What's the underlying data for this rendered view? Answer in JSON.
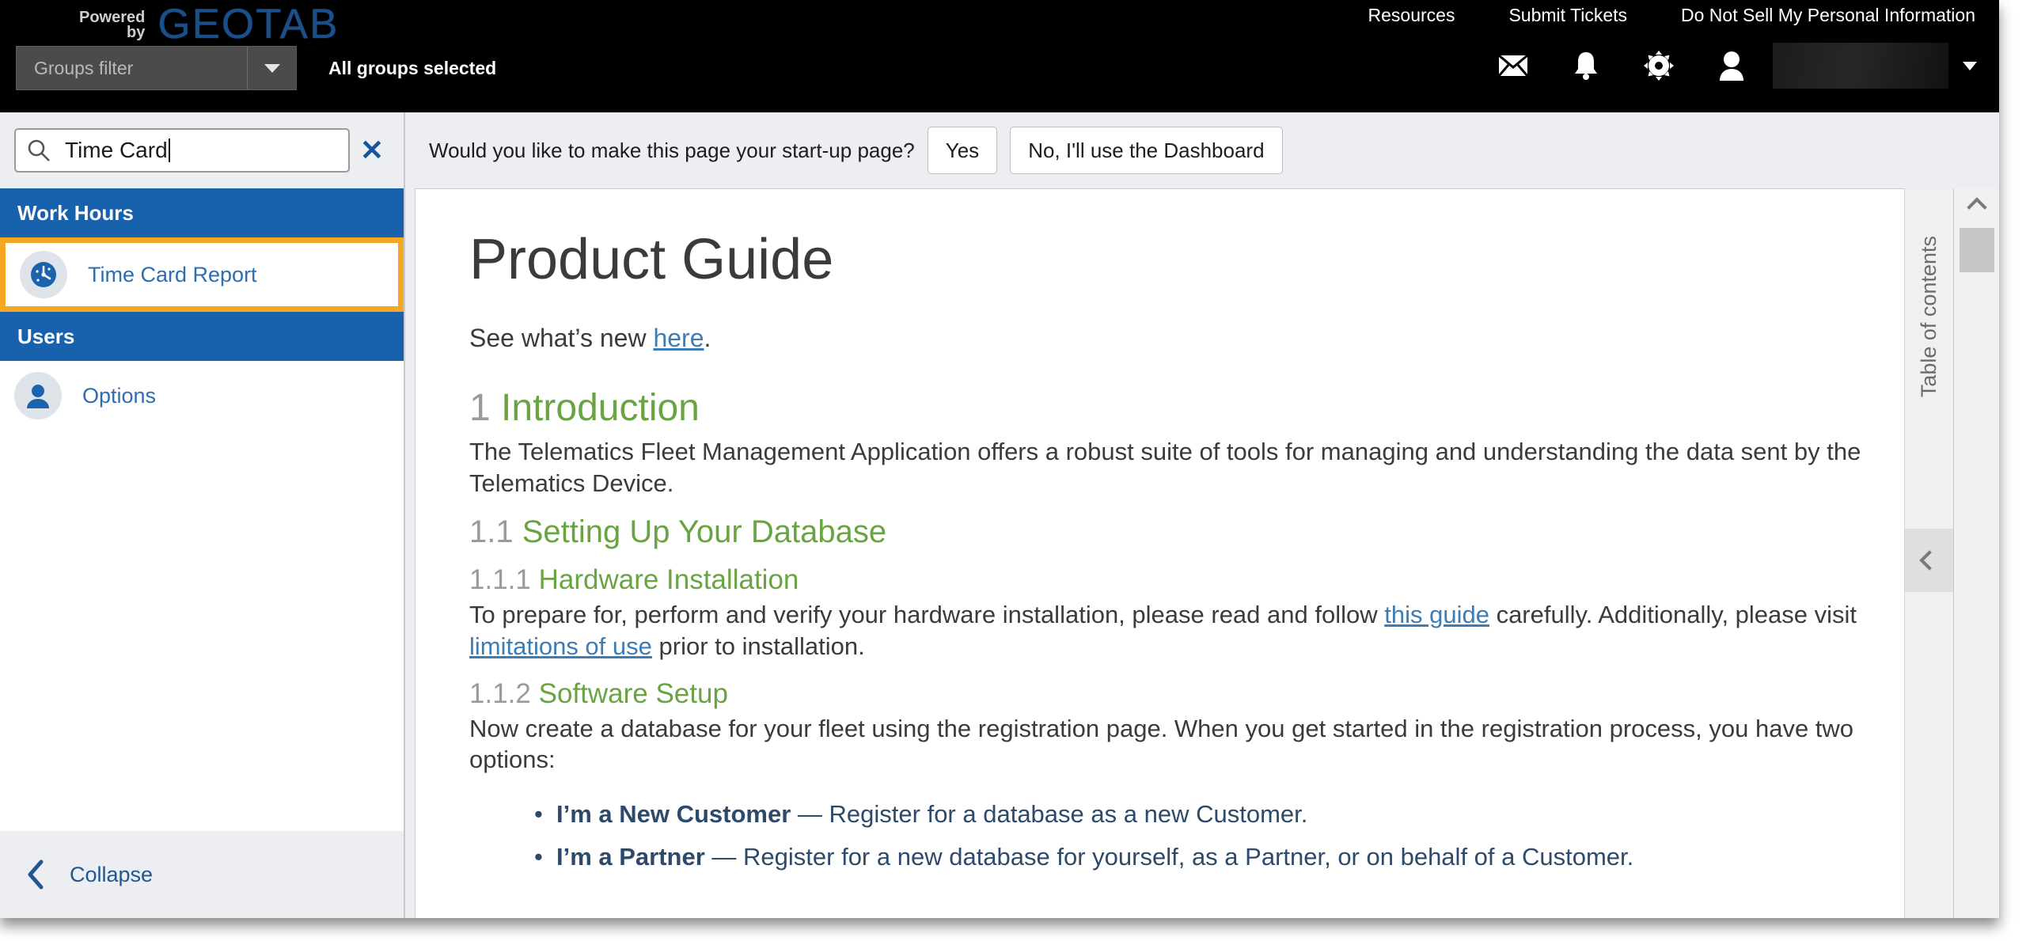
{
  "header": {
    "brand": {
      "powered_line1": "Powered",
      "powered_line2": "by",
      "logo": "GEOTAB"
    },
    "links": [
      {
        "label": "Resources",
        "name": "resources"
      },
      {
        "label": "Submit Tickets",
        "name": "submit-tickets"
      },
      {
        "label": "Do Not Sell My Personal Information",
        "name": "do-not-sell"
      }
    ],
    "groups_filter": {
      "placeholder": "Groups filter",
      "value": "",
      "status": "All groups selected"
    },
    "icons": [
      {
        "name": "mail-icon"
      },
      {
        "name": "bell-icon"
      },
      {
        "name": "gear-icon"
      },
      {
        "name": "user-icon"
      }
    ],
    "user_menu": {
      "label": ""
    }
  },
  "sidebar": {
    "search": {
      "value": "Time Card",
      "placeholder": "Search",
      "clear_label": "✕"
    },
    "groups": [
      {
        "title": "Work Hours",
        "items": [
          {
            "label": "Time Card Report",
            "icon": "clock-icon",
            "highlighted": true
          }
        ]
      },
      {
        "title": "Users",
        "items": [
          {
            "label": "Options",
            "icon": "person-icon",
            "highlighted": false
          }
        ]
      }
    ],
    "collapse": {
      "label": "Collapse",
      "icon": "chevron-left-icon"
    }
  },
  "startup_prompt": {
    "question": "Would you like to make this page your start-up page?",
    "yes_label": "Yes",
    "no_label": "No, I'll use the Dashboard"
  },
  "document": {
    "title": "Product Guide",
    "see_new_prefix": "See what’s new ",
    "see_new_link": "here",
    "see_new_suffix": ".",
    "sections": {
      "intro": {
        "number": "1",
        "heading": "Introduction",
        "paragraph": "The Telematics Fleet Management Application offers a robust suite of tools for managing and understanding the data sent by the Telematics Device."
      },
      "setup": {
        "number": "1.1",
        "heading": "Setting Up Your Database"
      },
      "hardware": {
        "number": "1.1.1",
        "heading": "Hardware Installation",
        "p_part1": "To prepare for, perform and verify your hardware installation, please read and follow ",
        "p_link1": "this guide",
        "p_part2": " carefully. Additionally, please visit ",
        "p_link2": "limitations of use",
        "p_part3": " prior to installation."
      },
      "software": {
        "number": "1.1.2",
        "heading": "Software Setup",
        "paragraph": "Now create a database for your fleet using the registration page. When you get started in the registration process, you have two options:",
        "options": [
          {
            "term": "I’m a New Customer",
            "desc": " — Register for a database as a new Customer."
          },
          {
            "term": "I’m a Partner",
            "desc": " — Register for a new database for yourself, as a Partner, or on behalf of a Customer."
          }
        ]
      }
    }
  },
  "toc": {
    "label": "Table of contents",
    "handle_icon": "chevron-left-icon"
  },
  "scrollbar": {
    "up_icon": "chevron-up-icon"
  },
  "colors": {
    "header_bg": "#000000",
    "brand_blue": "#1b4f8a",
    "nav_group_blue": "#1861ad",
    "highlight_orange": "#f5a623",
    "link_blue": "#3d7cb5",
    "heading_green": "#6aa442",
    "sidebar_bg": "#eceef1"
  }
}
